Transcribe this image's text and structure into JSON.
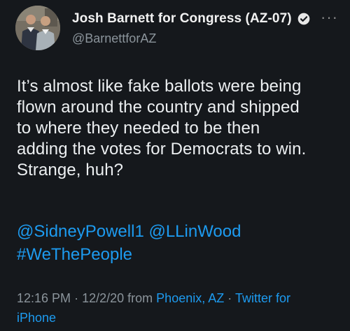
{
  "tweet": {
    "author": {
      "display_name": "Josh Barnett for Congress (AZ-07)",
      "handle": "@BarnettforAZ"
    },
    "text_lines": [
      "It’s almost like fake ballots were being",
      "flown around the country and shipped",
      "to where they needed to be then",
      "adding the votes for Democrats to win.",
      "Strange, huh?"
    ],
    "mentions": [
      "@SidneyPowell1",
      "@LLinWood"
    ],
    "hashtag": "#WeThePeople",
    "meta": {
      "time": "12:16 PM",
      "separator": "·",
      "date": "12/2/20",
      "from_label": "from",
      "location": "Phoenix, AZ",
      "source": "Twitter for",
      "source_line2": "iPhone"
    },
    "more_label": "···"
  },
  "icons": {
    "verified": "verified-badge-icon",
    "more": "more-options-icon",
    "avatar": "avatar-photo"
  },
  "colors": {
    "background": "#15181c",
    "text": "#eceff1",
    "secondary": "#8b949b",
    "link": "#1d9bf0"
  }
}
